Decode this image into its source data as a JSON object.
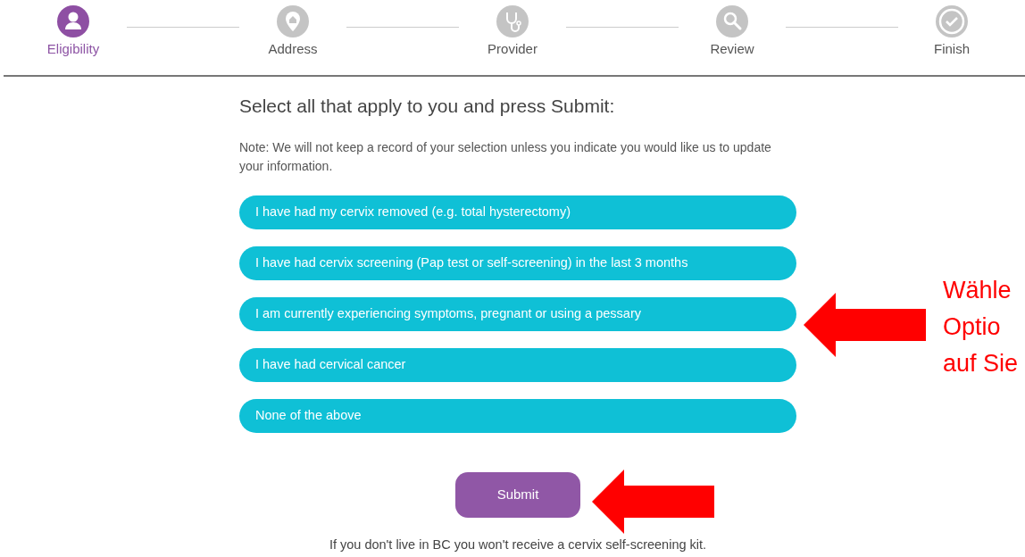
{
  "steps": [
    {
      "label": "Eligibility",
      "selected": true
    },
    {
      "label": "Address",
      "selected": false
    },
    {
      "label": "Provider",
      "selected": false
    },
    {
      "label": "Review",
      "selected": false
    },
    {
      "label": "Finish",
      "selected": false
    }
  ],
  "heading": "Select all that apply to you and press Submit:",
  "note": "Note: We will not keep a record of your selection unless you indicate you would like us to update your information.",
  "options": [
    "I have had my cervix removed (e.g. total hysterectomy)",
    "I have had cervix screening (Pap test or self-screening) in the last 3 months",
    "I am currently experiencing symptoms, pregnant or using a pessary",
    "I have had cervical cancer",
    "None of the above"
  ],
  "submit": "Submit",
  "footer": "If you don't live in BC you won't receive a cervix self-screening kit.",
  "callout": [
    "Wähle",
    "Optio",
    "auf Sie"
  ]
}
